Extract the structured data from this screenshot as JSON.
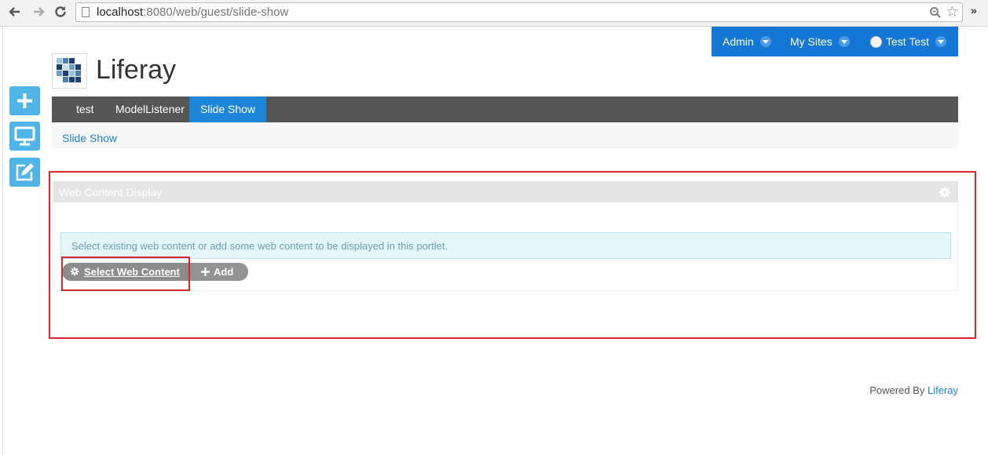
{
  "browser": {
    "url_host": "localhost",
    "url_rest": ":8080/web/guest/slide-show",
    "more": "»"
  },
  "dockbar": {
    "admin": "Admin",
    "my_sites": "My Sites",
    "user": "Test Test"
  },
  "site": {
    "name": "Liferay"
  },
  "nav": {
    "items": [
      {
        "label": "test",
        "active": false
      },
      {
        "label": "ModelListener",
        "active": false
      },
      {
        "label": "Slide Show",
        "active": true
      }
    ]
  },
  "breadcrumb": {
    "current": "Slide Show"
  },
  "portlet": {
    "title": "Web Content Display",
    "info": "Select existing web content or add some web content to be displayed in this portlet.",
    "select_label": "Select Web Content",
    "add_label": "Add"
  },
  "footer": {
    "powered_by": "Powered By",
    "brand": "Liferay"
  },
  "colors": {
    "dockbar": "#1477d5",
    "nav_active": "#1c86d8",
    "annotation_red": "#d9262c",
    "side_buttons": "#4fb4e8"
  }
}
